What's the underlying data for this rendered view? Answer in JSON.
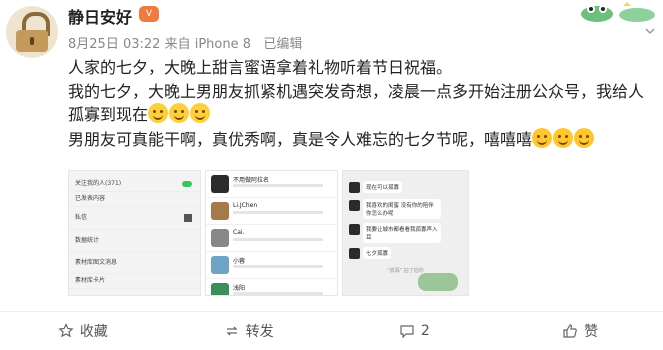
{
  "author": {
    "name": "静日安好",
    "vip_badge": "V"
  },
  "post": {
    "date": "8月25日",
    "time": "03:22",
    "source": "来自 iPhone 8",
    "edited": "已编辑",
    "lines": [
      "人家的七夕，大晚上甜言蜜语拿着礼物听着节日祝福。",
      "我的七夕，大晚上男朋友抓紧机遇突发奇想，凌晨一点多开始注册公众号，我给人孤寡到现在",
      "男朋友可真能干啊，真优秀啊，真是令人难忘的七夕节呢，嘻嘻嘻"
    ]
  },
  "screenshots": {
    "left_rows": [
      "关注我的人(371)",
      "已发表内容",
      "私信",
      "数据统计",
      "素材库图文消息",
      "素材库卡片"
    ],
    "middle_chats": [
      {
        "name": "不用做阿拉名"
      },
      {
        "name": "Li.JChen"
      },
      {
        "name": "Cai."
      },
      {
        "name": "小蓉"
      },
      {
        "name": "浅阳"
      }
    ],
    "right_messages": [
      "现在可以孤寡",
      "我喜欢的闺蜜 没有你的陪伴 你怎么办呢",
      "我要让城市都看看我孤寡声入耳",
      "七夕孤寡"
    ],
    "right_system": "\"孤寡\" 拍了拍你"
  },
  "actions": {
    "favorite": "收藏",
    "repost": "转发",
    "comment": "2",
    "like": "赞"
  },
  "colors": {
    "text": "#222222",
    "meta": "#888888",
    "badge": "#f07b3f"
  }
}
